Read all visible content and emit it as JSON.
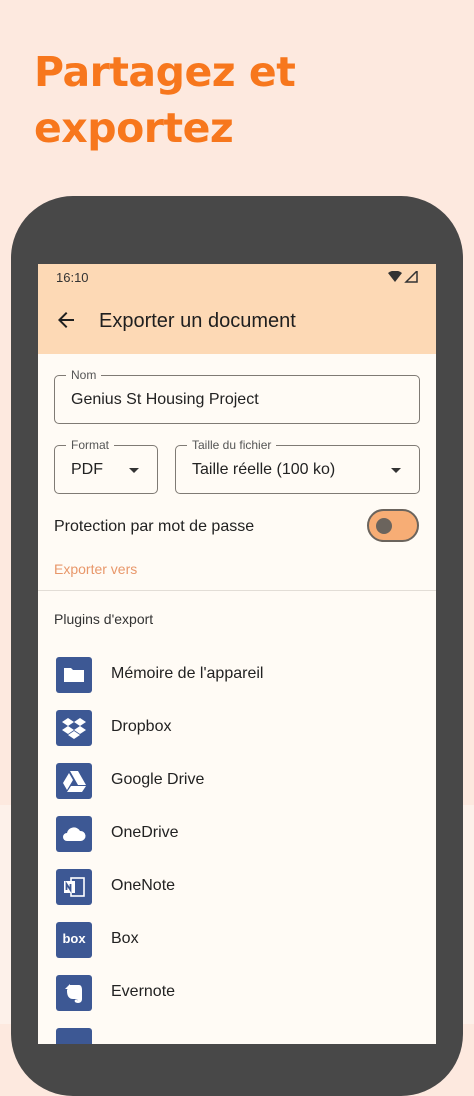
{
  "promo": {
    "line1": "Partagez et",
    "line2": "exportez"
  },
  "status_bar": {
    "time": "16:10"
  },
  "app_bar": {
    "title": "Exporter un document"
  },
  "form": {
    "name_label": "Nom",
    "name_value": "Genius St Housing Project",
    "format_label": "Format",
    "format_value": "PDF",
    "size_label": "Taille du fichier",
    "size_value": "Taille réelle (100 ko)",
    "password_label": "Protection par mot de passe",
    "password_enabled": false,
    "export_to": "Exporter vers"
  },
  "plugins": {
    "header": "Plugins d'export",
    "items": [
      {
        "label": "Mémoire de l'appareil",
        "icon": "folder-icon"
      },
      {
        "label": "Dropbox",
        "icon": "dropbox-icon"
      },
      {
        "label": "Google Drive",
        "icon": "google-drive-icon"
      },
      {
        "label": "OneDrive",
        "icon": "onedrive-icon"
      },
      {
        "label": "OneNote",
        "icon": "onenote-icon"
      },
      {
        "label": "Box",
        "icon": "box-icon",
        "icon_text": "box"
      },
      {
        "label": "Evernote",
        "icon": "evernote-icon"
      }
    ]
  },
  "colors": {
    "accent": "#f7771d",
    "app_bar": "#fdd9b5",
    "plugin_icon_bg": "#3d5894",
    "toggle_track": "#f7ad75"
  }
}
